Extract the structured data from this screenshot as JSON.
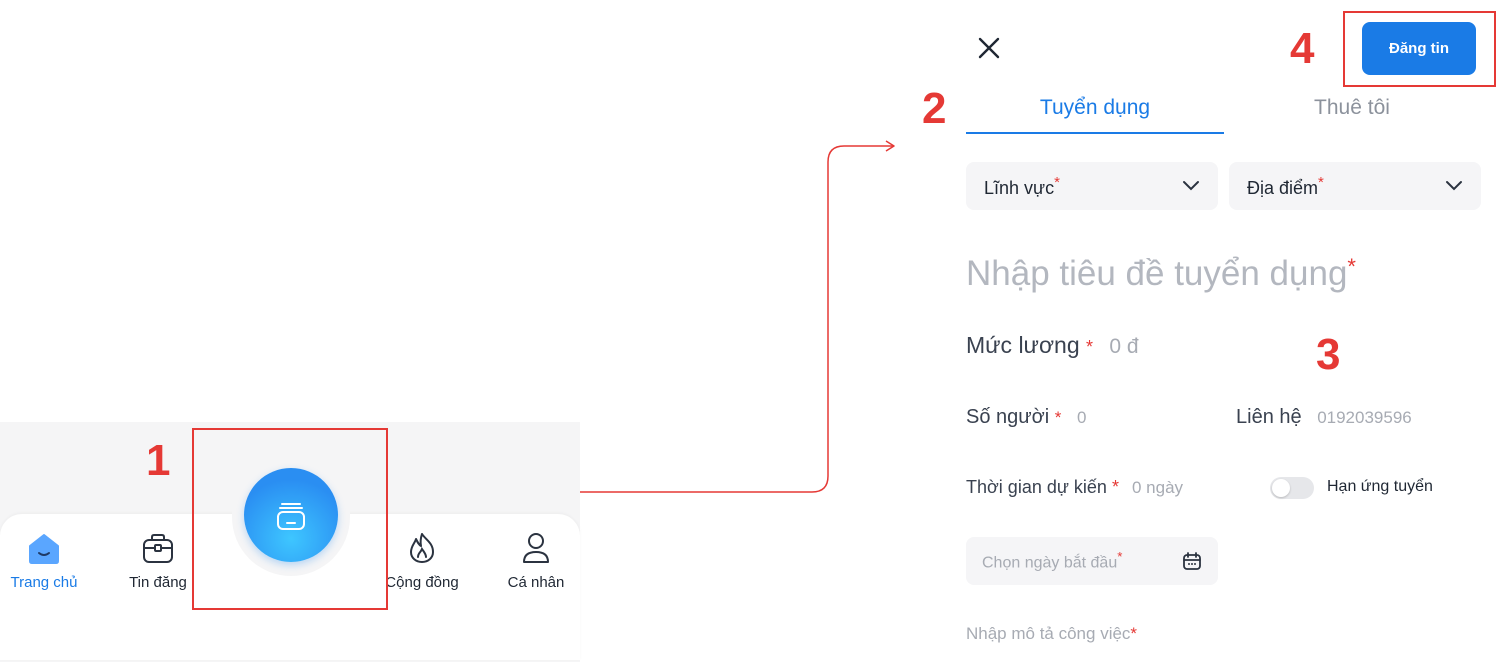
{
  "annotations": {
    "step1": "1",
    "step2": "2",
    "step3": "3",
    "step4": "4"
  },
  "bottom_nav": {
    "items": [
      {
        "label": "Trang chủ",
        "icon": "home-icon",
        "active": true
      },
      {
        "label": "Tin đăng",
        "icon": "briefcase-icon"
      },
      {
        "label": "Cộng đồng",
        "icon": "fire-icon"
      },
      {
        "label": "Cá nhân",
        "icon": "user-icon"
      }
    ],
    "fab_icon": "post-stack-icon"
  },
  "header": {
    "close_icon": "close-icon",
    "post_button": "Đăng tin"
  },
  "tabs": [
    {
      "label": "Tuyển dụng",
      "active": true
    },
    {
      "label": "Thuê tôi",
      "active": false
    }
  ],
  "form": {
    "field_dropdown": {
      "label": "Lĩnh vực",
      "required": "*"
    },
    "location_dropdown": {
      "label": "Địa điểm",
      "required": "*"
    },
    "title_placeholder": "Nhập tiêu đề tuyển dụng",
    "salary_label": "Mức lương",
    "salary_value": "0 đ",
    "people_label": "Số người",
    "people_value": "0",
    "contact_label": "Liên hệ",
    "contact_value": "0192039596",
    "duration_label": "Thời gian dự kiến",
    "duration_value": "0 ngày",
    "deadline_toggle_label": "Hạn ứng tuyển",
    "start_date_placeholder": "Chọn ngày bắt đầu",
    "description_placeholder": "Nhập mô tả công việc",
    "required_mark": "*"
  },
  "colors": {
    "accent": "#1a7be6",
    "required": "#e53935",
    "annotation": "#e53935"
  }
}
